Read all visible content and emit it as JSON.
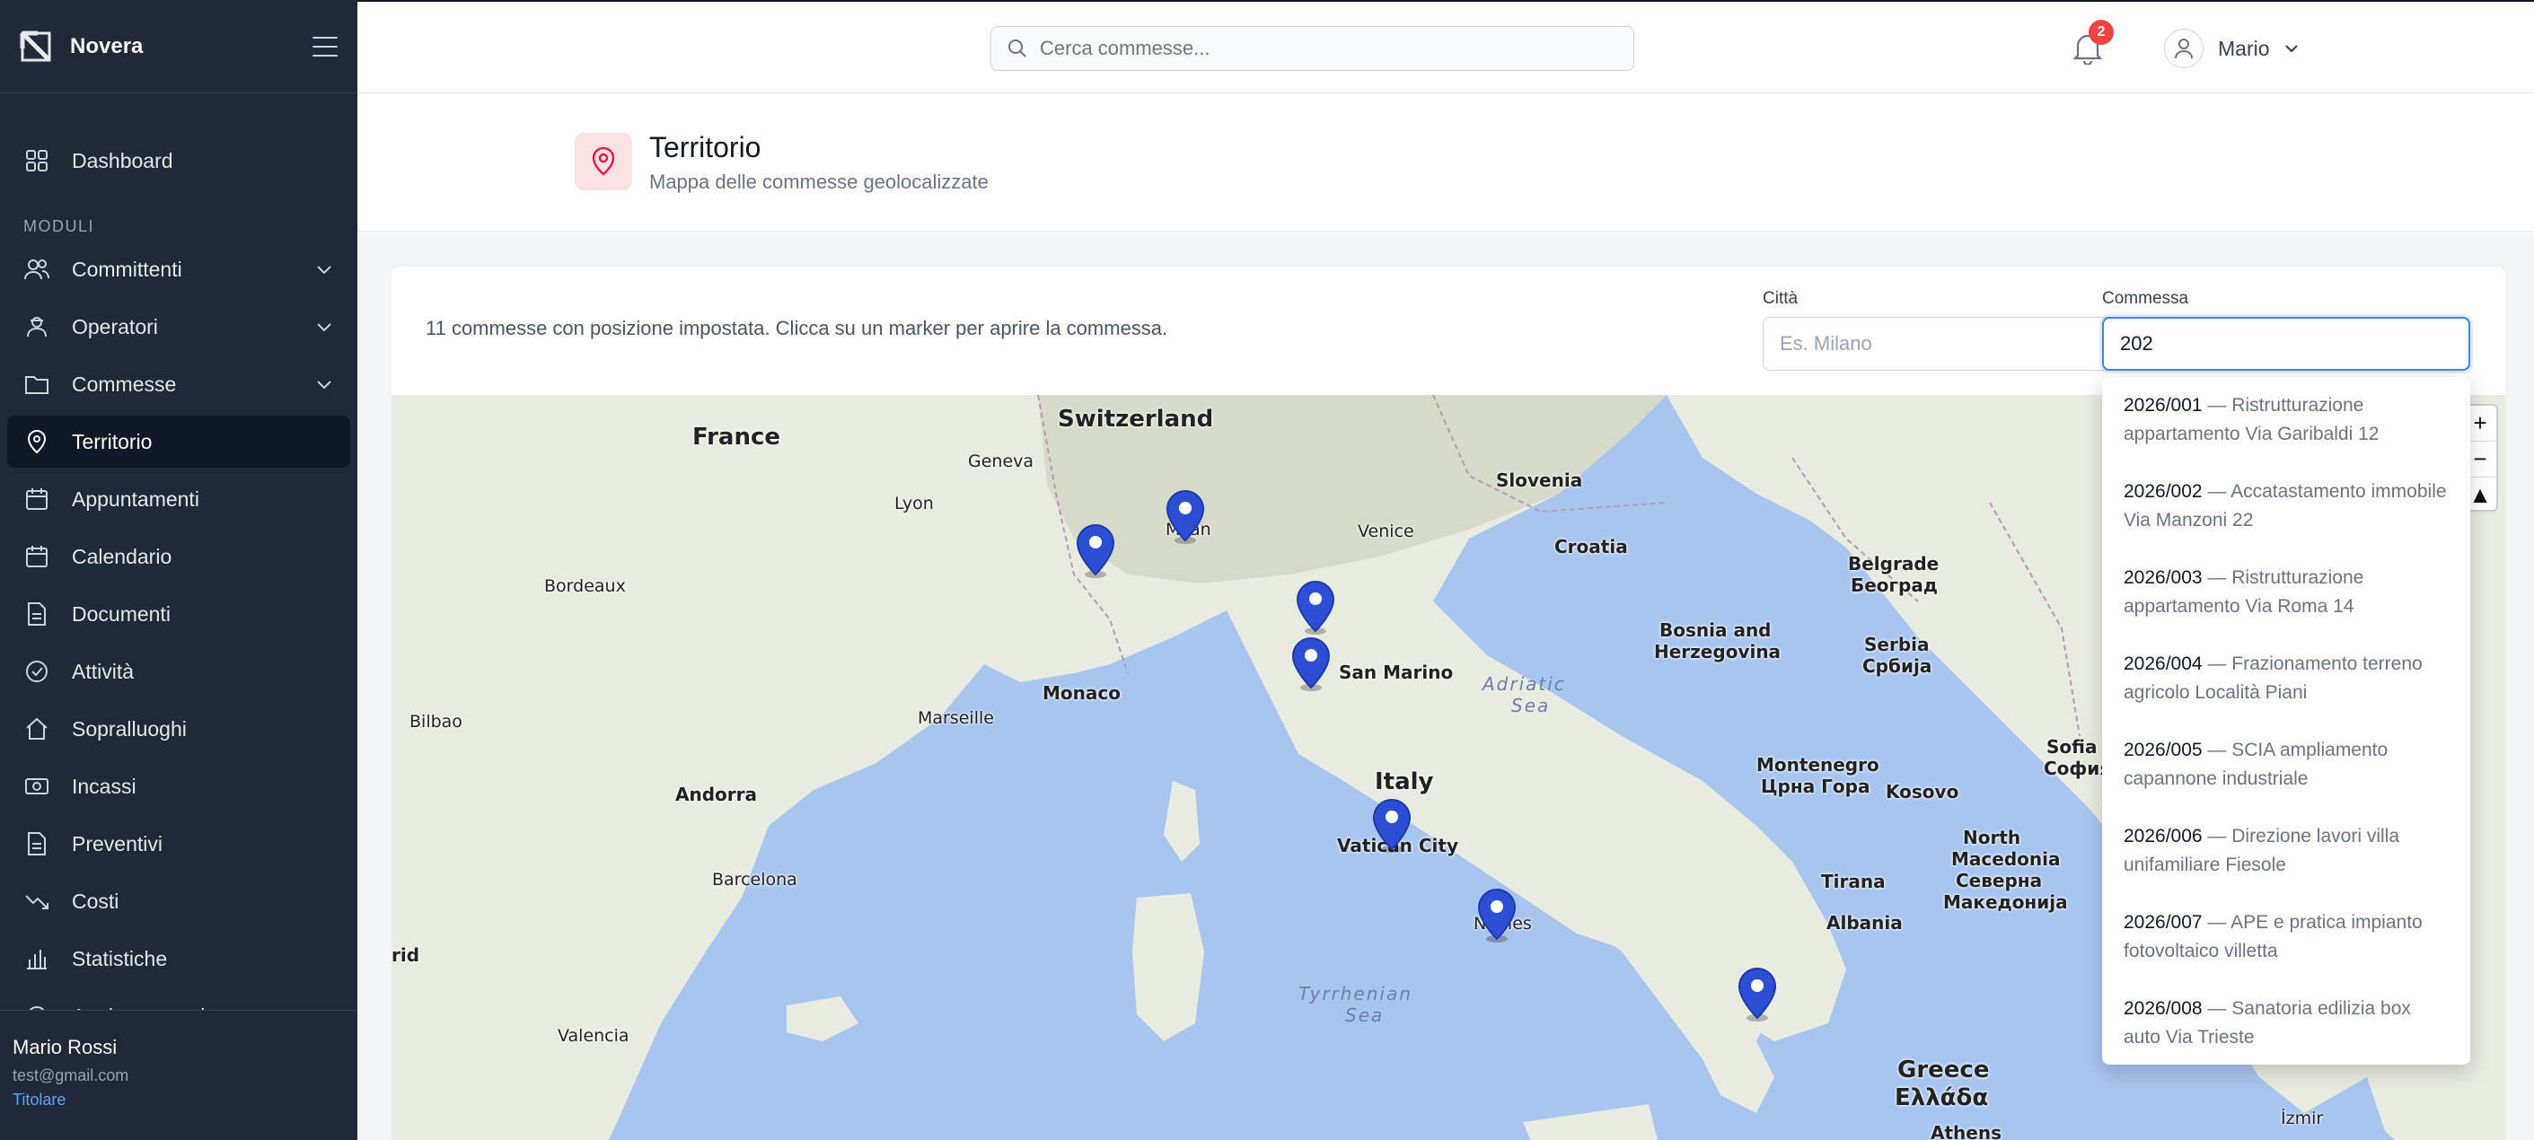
{
  "app": {
    "name": "Novera"
  },
  "sidebar": {
    "dashboard": "Dashboard",
    "section_label": "MODULI",
    "items": [
      {
        "label": "Committenti"
      },
      {
        "label": "Operatori"
      },
      {
        "label": "Commesse"
      },
      {
        "label": "Territorio"
      },
      {
        "label": "Appuntamenti"
      },
      {
        "label": "Calendario"
      },
      {
        "label": "Documenti"
      },
      {
        "label": "Attività"
      },
      {
        "label": "Sopralluoghi"
      },
      {
        "label": "Incassi"
      },
      {
        "label": "Preventivi"
      },
      {
        "label": "Costi"
      },
      {
        "label": "Statistiche"
      },
      {
        "label": "Aggiornamenti"
      }
    ],
    "user": {
      "name": "Mario Rossi",
      "email": "test@gmail.com",
      "role": "Titolare"
    }
  },
  "topbar": {
    "search_placeholder": "Cerca commesse...",
    "notifications_count": "2",
    "user_name": "Mario"
  },
  "page": {
    "title": "Territorio",
    "subtitle": "Mappa delle commesse geolocalizzate"
  },
  "filters": {
    "info_text": "11 commesse con posizione impostata. Clicca su un marker per aprire la commessa.",
    "city_label": "Città",
    "city_placeholder": "Es. Milano",
    "commessa_label": "Commessa",
    "commessa_value": "202"
  },
  "map": {
    "labels": {
      "france": "France",
      "switzerland": "Switzerland",
      "slovenia": "Slovenia",
      "croatia": "Croatia",
      "italy": "Italy",
      "greece_line1": "Greece",
      "greece_line2": "Ελλάδα",
      "geneva": "Geneva",
      "lyon": "Lyon",
      "venice": "Venice",
      "bordeaux": "Bordeaux",
      "milan": "Milan",
      "monaco": "Monaco",
      "san_marino": "San Marino",
      "marseille": "Marseille",
      "bilbao": "Bilbao",
      "andorra": "Andorra",
      "barcelona": "Barcelona",
      "valencia": "Valencia",
      "madrid_partial": "rid",
      "vatican": "Vatican City",
      "naples": "Naples",
      "bosnia_line1": "Bosnia and",
      "bosnia_line2": "Herzegovina",
      "belgrade_line1": "Belgrade",
      "belgrade_line2": "Београд",
      "serbia_line1": "Serbia",
      "serbia_line2": "Србија",
      "montenegro_line1": "Montenegro",
      "montenegro_line2": "Црна Гора",
      "kosovo": "Kosovo",
      "sofia_line1": "Sofia",
      "sofia_line2": "София",
      "nmacedonia_line1": "North",
      "nmacedonia_line2": "Macedonia",
      "nmacedonia_line3": "Северна",
      "nmacedonia_line4": "Македонија",
      "tirana": "Tirana",
      "albania": "Albania",
      "athens": "Athens",
      "izmir": "İzmir",
      "adriatic_line1": "Adriatic",
      "adriatic_line2": "Sea",
      "tyrrhenian_line1": "Tyrrhenian",
      "tyrrhenian_line2": "Sea"
    },
    "zoom_in": "+",
    "zoom_out": "−"
  },
  "dropdown": [
    {
      "code": "2026/001",
      "desc": " — Ristrutturazione appartamento Via Garibaldi 12"
    },
    {
      "code": "2026/002",
      "desc": " — Accatastamento immobile Via Manzoni 22"
    },
    {
      "code": "2026/003",
      "desc": " — Ristrutturazione appartamento Via Roma 14"
    },
    {
      "code": "2026/004",
      "desc": " — Frazionamento terreno agricolo Località Piani"
    },
    {
      "code": "2026/005",
      "desc": " — SCIA ampliamento capannone industriale"
    },
    {
      "code": "2026/006",
      "desc": " — Direzione lavori villa unifamiliare Fiesole"
    },
    {
      "code": "2026/007",
      "desc": " — APE e pratica impianto fotovoltaico villetta"
    },
    {
      "code": "2026/008",
      "desc": " — Sanatoria edilizia box auto Via Trieste"
    }
  ]
}
